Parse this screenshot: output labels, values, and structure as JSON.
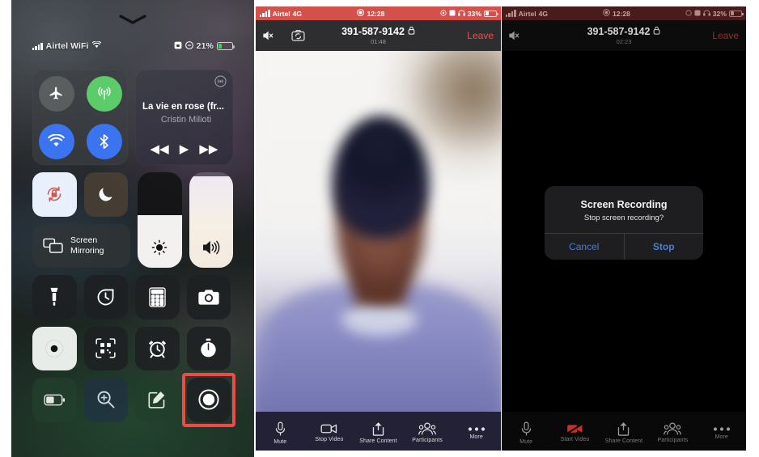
{
  "panel1": {
    "name": "ios-control-center",
    "status": {
      "carrier": "Airtel WiFi",
      "battery_percent": "21%"
    },
    "connectivity": {
      "airplane": "airplane-mode",
      "cellular": "cellular-data",
      "wifi": "wifi",
      "bluetooth": "bluetooth"
    },
    "music": {
      "title": "La vie en rose (fr...",
      "artist": "Cristin Milioti",
      "prev": "◀◀",
      "play": "▶",
      "next": "▶▶"
    },
    "screen_mirroring": {
      "line1": "Screen",
      "line2": "Mirroring"
    },
    "sliders": {
      "brightness_percent": 55,
      "volume_percent": 96
    },
    "tiles": [
      "flashlight",
      "timer",
      "calculator",
      "camera",
      "dark-mode",
      "qr-scanner",
      "alarm",
      "stopwatch",
      "low-power-mode",
      "magnifier",
      "notes",
      "screen-recording"
    ],
    "highlight": {
      "target": "screen-recording",
      "color": "#f04a46"
    }
  },
  "panel2": {
    "name": "zoom-meeting-recording-active",
    "status": {
      "carrier": "Airtel",
      "network": "4G",
      "time": "12:28",
      "battery_percent": "33%"
    },
    "topbar": {
      "meeting_id": "391-587-9142",
      "elapsed": "01:48",
      "leave_label": "Leave"
    },
    "toolbar": [
      {
        "label": "Mute",
        "icon": "microphone-icon"
      },
      {
        "label": "Stop Video",
        "icon": "video-camera-icon"
      },
      {
        "label": "Share Content",
        "icon": "share-up-icon"
      },
      {
        "label": "Participants",
        "icon": "participants-icon"
      },
      {
        "label": "More",
        "icon": "more-dots-icon"
      }
    ]
  },
  "panel3": {
    "name": "zoom-meeting-stop-recording-dialog",
    "status": {
      "carrier": "Airtel",
      "network": "4G",
      "time": "12:28",
      "battery_percent": "32%"
    },
    "topbar": {
      "meeting_id": "391-587-9142",
      "elapsed": "02:23",
      "leave_label": "Leave"
    },
    "alert": {
      "title": "Screen Recording",
      "message": "Stop screen recording?",
      "cancel_label": "Cancel",
      "confirm_label": "Stop"
    },
    "toolbar": [
      {
        "label": "Mute",
        "icon": "microphone-icon"
      },
      {
        "label": "Start Video",
        "icon": "video-camera-off-icon"
      },
      {
        "label": "Share Content",
        "icon": "share-up-icon"
      },
      {
        "label": "Participants",
        "icon": "participants-icon"
      },
      {
        "label": "More",
        "icon": "more-dots-icon"
      }
    ]
  }
}
